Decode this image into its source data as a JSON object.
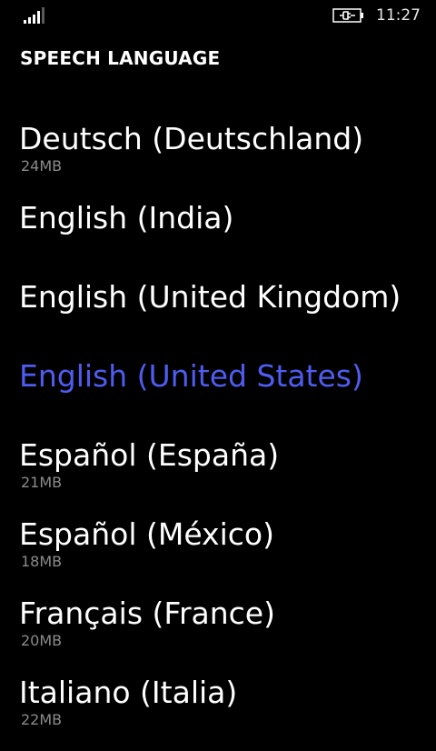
{
  "status": {
    "time": "11:27",
    "signal_icon": "signal-bars-icon",
    "battery_icon": "battery-charging-icon"
  },
  "header": {
    "title": "SPEECH LANGUAGE"
  },
  "colors": {
    "background": "#000000",
    "text": "#ffffff",
    "accent": "#4f5cf0",
    "subtext": "#8a8a8a"
  },
  "languages": [
    {
      "name": "Deutsch (Deutschland)",
      "size": "24MB",
      "selected": false
    },
    {
      "name": "English (India)",
      "size": "",
      "selected": false
    },
    {
      "name": "English (United Kingdom)",
      "size": "",
      "selected": false
    },
    {
      "name": "English (United States)",
      "size": "",
      "selected": true
    },
    {
      "name": "Español (España)",
      "size": "21MB",
      "selected": false
    },
    {
      "name": "Español (México)",
      "size": "18MB",
      "selected": false
    },
    {
      "name": "Français (France)",
      "size": "20MB",
      "selected": false
    },
    {
      "name": "Italiano (Italia)",
      "size": "22MB",
      "selected": false
    }
  ]
}
